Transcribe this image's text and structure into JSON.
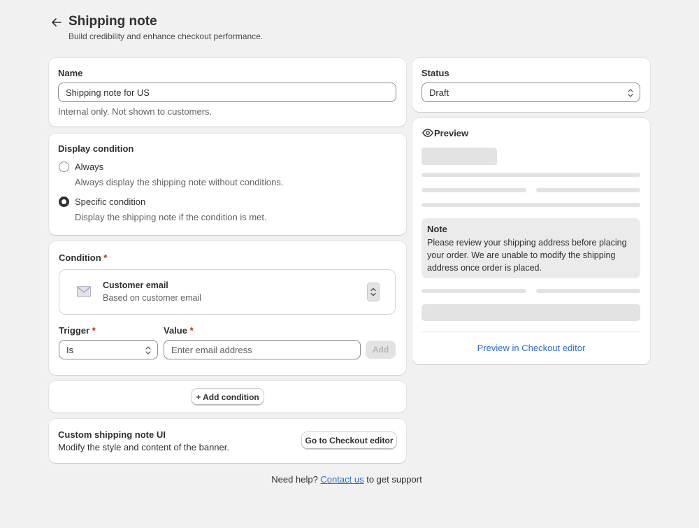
{
  "header": {
    "title": "Shipping note",
    "subtitle": "Build credibility and enhance checkout performance."
  },
  "name_card": {
    "label": "Name",
    "value": "Shipping note for US",
    "help": "Internal only. Not shown to customers."
  },
  "display_condition": {
    "title": "Display condition",
    "options": [
      {
        "label": "Always",
        "description": "Always display the shipping note without conditions.",
        "checked": false
      },
      {
        "label": "Specific condition",
        "description": "Display the shipping note if the condition is met.",
        "checked": true
      }
    ]
  },
  "condition": {
    "title": "Condition",
    "required_mark": "*",
    "type_title": "Customer email",
    "type_description": "Based on customer email",
    "trigger_label": "Trigger",
    "trigger_value": "Is",
    "value_label": "Value",
    "value_placeholder": "Enter email address",
    "add_label": "Add"
  },
  "add_condition": {
    "label": "+ Add condition"
  },
  "custom_ui": {
    "title": "Custom shipping note UI",
    "description": "Modify the style and content of the banner.",
    "button_label": "Go to Checkout editor"
  },
  "footer": {
    "prefix": "Need help?",
    "link": "Contact us",
    "suffix": "to get support"
  },
  "status": {
    "label": "Status",
    "value": "Draft"
  },
  "preview": {
    "title": "Preview",
    "note_title": "Note",
    "note_text": "Please review your shipping address before placing your order. We are unable to modify the shipping address once order is placed.",
    "editor_link": "Preview in Checkout editor"
  },
  "icons": {
    "back": "arrow-left-icon",
    "eye": "eye-icon",
    "email": "envelope-icon",
    "chevron": "select-chevron-icon"
  },
  "colors": {
    "background": "#f1f1f1",
    "card": "#ffffff",
    "link": "#2c6ecb",
    "required": "#c5280c",
    "note_background": "#ebebeb"
  }
}
